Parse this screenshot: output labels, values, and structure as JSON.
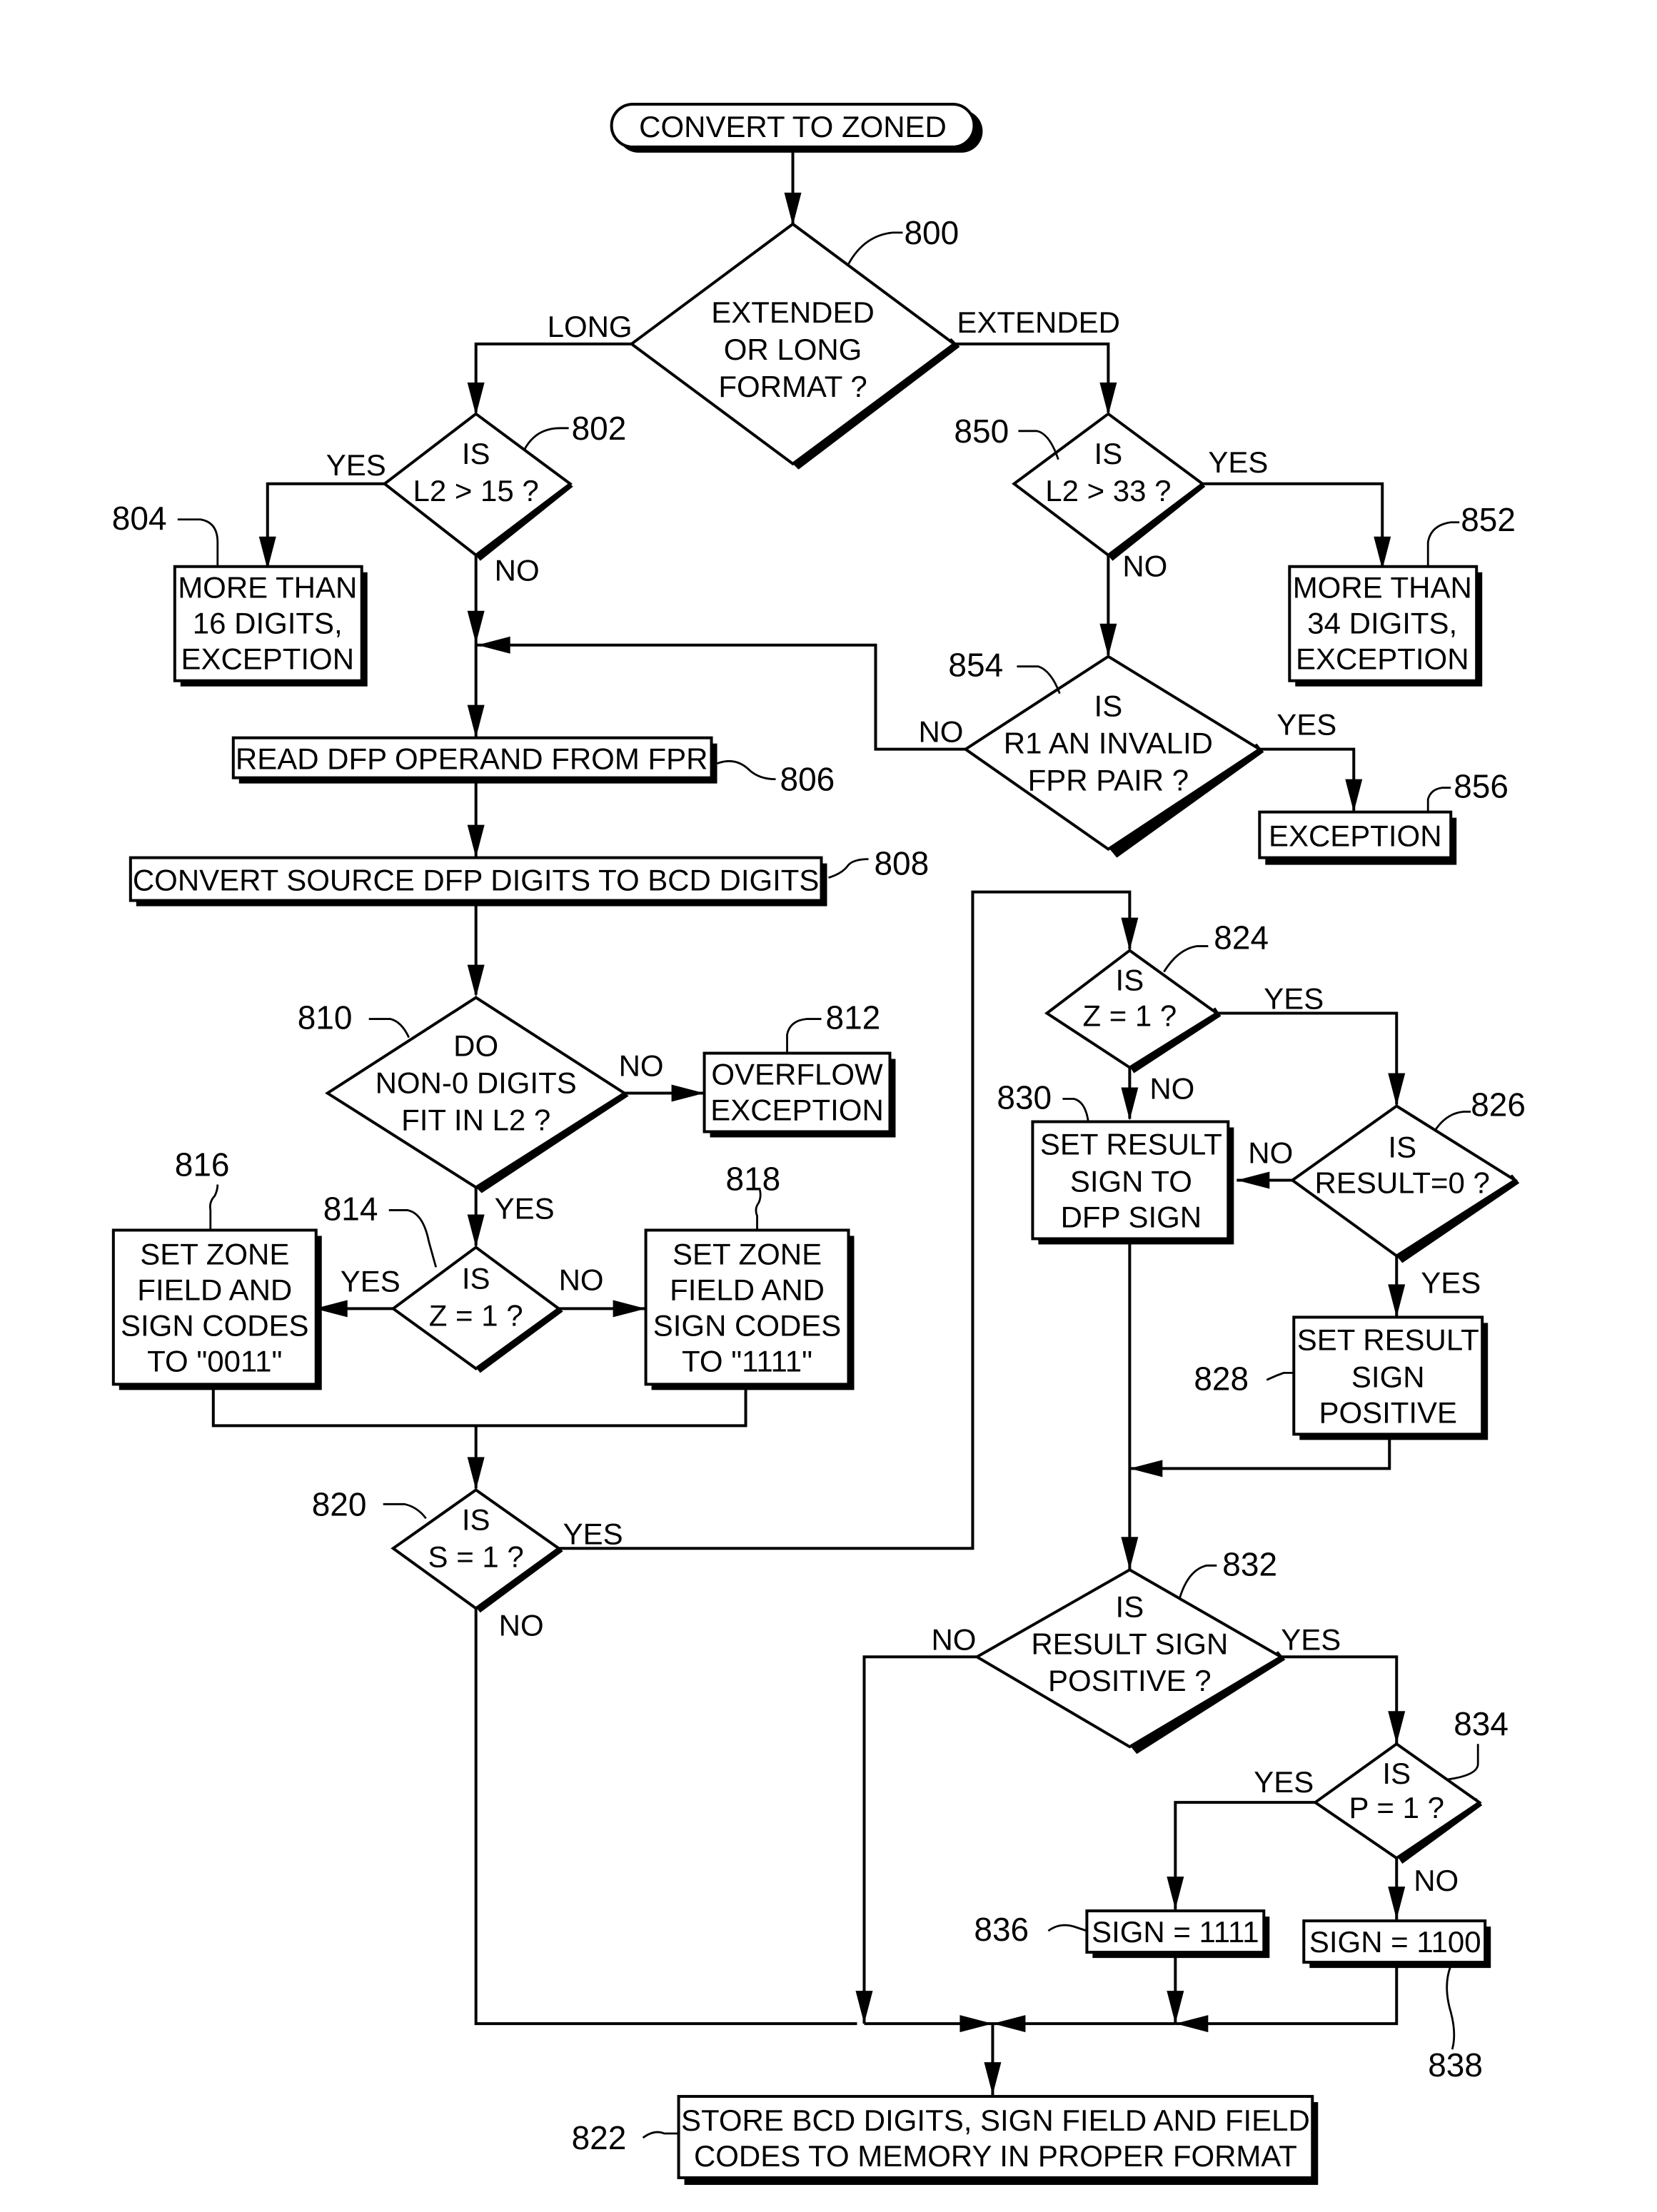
{
  "diagram": {
    "title": "CONVERT TO ZONED",
    "nodes": {
      "start": {
        "lines": [
          "CONVERT TO ZONED"
        ]
      },
      "n800": {
        "ref": "800",
        "lines": [
          "EXTENDED",
          "OR LONG",
          "FORMAT ?"
        ]
      },
      "n802": {
        "ref": "802",
        "lines": [
          "IS",
          "L2 > 15 ?"
        ]
      },
      "n804": {
        "ref": "804",
        "lines": [
          "MORE THAN",
          "16 DIGITS,",
          "EXCEPTION"
        ]
      },
      "n806": {
        "ref": "806",
        "lines": [
          "READ DFP OPERAND FROM FPR"
        ]
      },
      "n808": {
        "ref": "808",
        "lines": [
          "CONVERT SOURCE DFP DIGITS TO BCD DIGITS"
        ]
      },
      "n810": {
        "ref": "810",
        "lines": [
          "DO",
          "NON-0 DIGITS",
          "FIT IN L2 ?"
        ]
      },
      "n812": {
        "ref": "812",
        "lines": [
          "OVERFLOW",
          "EXCEPTION"
        ]
      },
      "n814": {
        "ref": "814",
        "lines": [
          "IS",
          "Z = 1 ?"
        ]
      },
      "n816": {
        "ref": "816",
        "lines": [
          "SET ZONE",
          "FIELD AND",
          "SIGN CODES",
          "TO \"0011\""
        ]
      },
      "n818": {
        "ref": "818",
        "lines": [
          "SET ZONE",
          "FIELD AND",
          "SIGN CODES",
          "TO \"1111\""
        ]
      },
      "n820": {
        "ref": "820",
        "lines": [
          "IS",
          "S = 1 ?"
        ]
      },
      "n822": {
        "ref": "822",
        "lines": [
          "STORE BCD DIGITS, SIGN FIELD AND FIELD",
          "CODES TO MEMORY IN PROPER FORMAT"
        ]
      },
      "n824": {
        "ref": "824",
        "lines": [
          "IS",
          "Z = 1 ?"
        ]
      },
      "n826": {
        "ref": "826",
        "lines": [
          "IS",
          "RESULT=0 ?"
        ]
      },
      "n828": {
        "ref": "828",
        "lines": [
          "SET RESULT",
          "SIGN",
          "POSITIVE"
        ]
      },
      "n830": {
        "ref": "830",
        "lines": [
          "SET RESULT",
          "SIGN TO",
          "DFP SIGN"
        ]
      },
      "n832": {
        "ref": "832",
        "lines": [
          "IS",
          "RESULT SIGN",
          "POSITIVE ?"
        ]
      },
      "n834": {
        "ref": "834",
        "lines": [
          "IS",
          "P = 1 ?"
        ]
      },
      "n836": {
        "ref": "836",
        "lines": [
          "SIGN = 1111"
        ]
      },
      "n838": {
        "ref": "838",
        "lines": [
          "SIGN = 1100"
        ]
      },
      "n850": {
        "ref": "850",
        "lines": [
          "IS",
          "L2 > 33 ?"
        ]
      },
      "n852": {
        "ref": "852",
        "lines": [
          "MORE THAN",
          "34 DIGITS,",
          "EXCEPTION"
        ]
      },
      "n854": {
        "ref": "854",
        "lines": [
          "IS",
          "R1 AN INVALID",
          "FPR PAIR ?"
        ]
      },
      "n856": {
        "ref": "856",
        "lines": [
          "EXCEPTION"
        ]
      }
    },
    "edge_labels": {
      "long": "LONG",
      "extended": "EXTENDED",
      "yes": "YES",
      "no": "NO"
    }
  }
}
